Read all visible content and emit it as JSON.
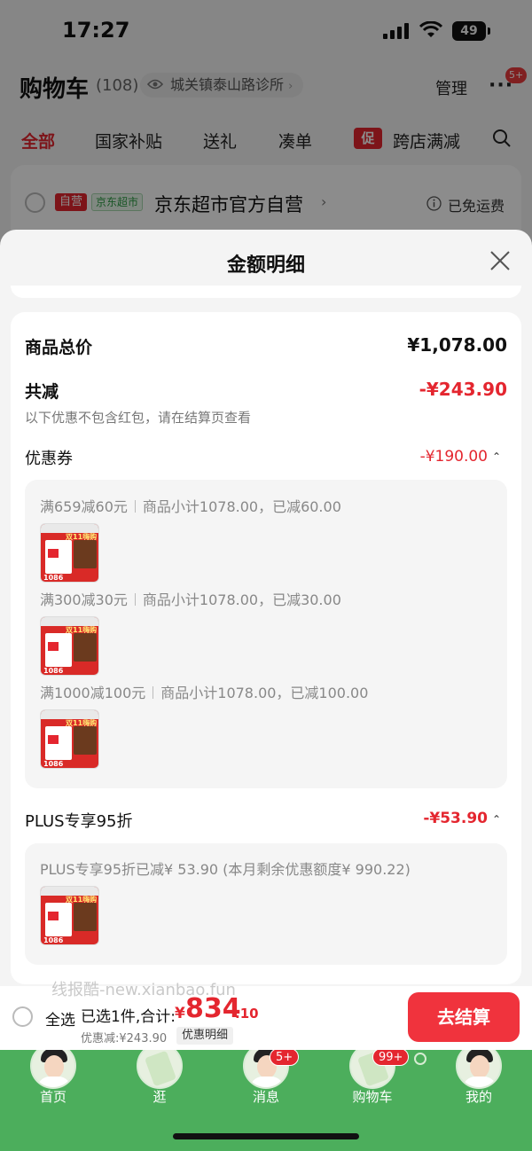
{
  "status_bar": {
    "time": "17:27",
    "battery": "49"
  },
  "header": {
    "title": "购物车",
    "count": "(108)",
    "address": "城关镇泰山路诊所",
    "manage": "管理",
    "more_badge": "5+"
  },
  "tabs": [
    {
      "label": "全部"
    },
    {
      "label": "国家补贴"
    },
    {
      "label": "送礼"
    },
    {
      "label": "凑单"
    },
    {
      "label": "促",
      "promo": true
    },
    {
      "label": "跨店满减"
    }
  ],
  "store": {
    "self_tag": "自营",
    "jd_tag": "京东超市",
    "name": "京东超市官方自营",
    "shipping": "已免运费"
  },
  "sheet": {
    "title": "金额明细",
    "total_label": "商品总价",
    "total_value": "¥1,078.00",
    "reduce_label": "共减",
    "reduce_value": "-¥243.90",
    "reduce_note": "以下优惠不包含红包，请在结算页查看",
    "coupon_label": "优惠券",
    "coupon_value": "-¥190.00",
    "coupons": [
      {
        "rule": "满659减60元",
        "detail": "商品小计1078.00，已减60.00"
      },
      {
        "rule": "满300减30元",
        "detail": "商品小计1078.00，已减30.00"
      },
      {
        "rule": "满1000减100元",
        "detail": "商品小计1078.00，已减100.00"
      }
    ],
    "plus_label": "PLUS专享95折",
    "plus_value": "-¥53.90",
    "plus_detail": "PLUS专享95折已减¥ 53.90 (本月剩余优惠额度¥ 990.22)",
    "thumb_banner": "双11嗨购",
    "thumb_num": "1086"
  },
  "watermark": "线报酷-new.xianbao.fun",
  "bottom": {
    "select_all": "全选",
    "selected": "已选1件,合计:",
    "currency": "¥",
    "total_int": "834",
    "total_dec": ".10",
    "discount": "优惠减:¥243.90",
    "detail": "优惠明细",
    "checkout": "去结算"
  },
  "nav": [
    {
      "label": "首页"
    },
    {
      "label": "逛"
    },
    {
      "label": "消息",
      "badge": "5+"
    },
    {
      "label": "购物车",
      "badge": "99+"
    },
    {
      "label": "我的"
    }
  ],
  "colors": {
    "accent": "#e4262f",
    "checkout": "#f0333d",
    "tabbar": "#4cae5c"
  },
  "icons": [
    "eye-icon",
    "more-icon",
    "search-icon",
    "info-icon",
    "close-icon",
    "caret-up-icon"
  ]
}
